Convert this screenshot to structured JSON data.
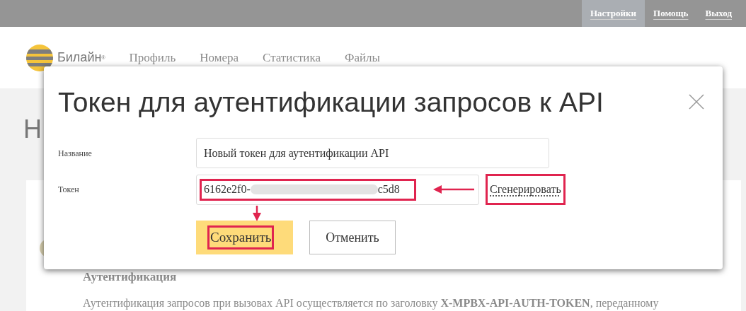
{
  "top_bar": {
    "links": [
      {
        "label": "Настройки",
        "selected": true
      },
      {
        "label": "Помощь",
        "selected": false
      },
      {
        "label": "Выход",
        "selected": false
      }
    ]
  },
  "header": {
    "logo_text": "Билайн",
    "logo_mark": "®",
    "nav": [
      "Профиль",
      "Номера",
      "Статистика",
      "Файлы"
    ]
  },
  "page": {
    "heading": "Н",
    "section_title": "Аутентификация",
    "paragraph": "Аутентификация запросов при вызовах API осуществляется по заголовку **X-MPBX-API-AUTH-TOKEN**, переданному"
  },
  "modal": {
    "title": "Токен для аутентификации запросов к API",
    "fields": [
      {
        "label": "Название",
        "value": "Новый токен для аутентификации API"
      },
      {
        "label": "Токен",
        "value_prefix": "6162e2f0-",
        "value_suffix": "c5d8",
        "link": "Сгенерировать"
      }
    ],
    "buttons": [
      {
        "label": "Сохранить",
        "kind": "primary"
      },
      {
        "label": "Отменить",
        "kind": "secondary"
      }
    ]
  }
}
